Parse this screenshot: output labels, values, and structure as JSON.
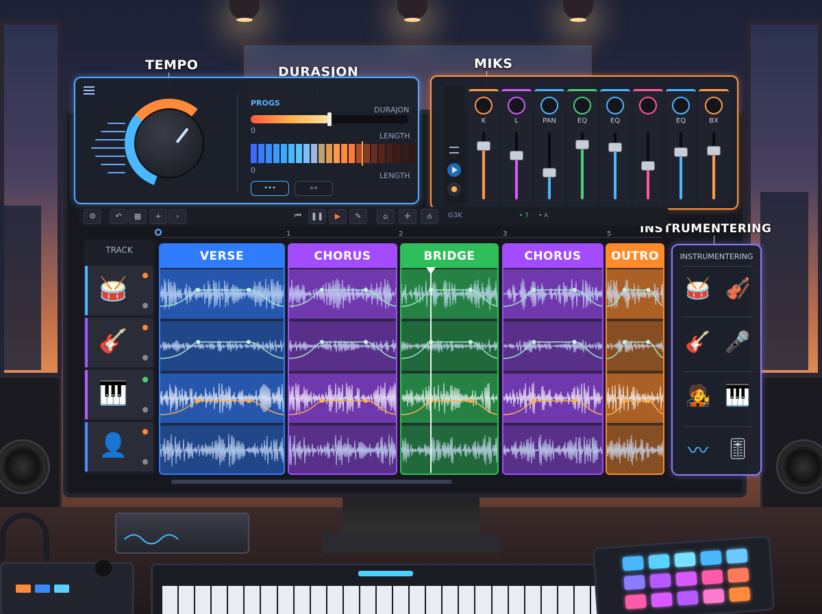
{
  "callouts": {
    "tempo": "TEMPO",
    "duration": "DURASJON",
    "mix": "MIKS",
    "instrumentation": "INSTRUMENTERING"
  },
  "tempo_panel": {
    "menu_icon": "hamburger-menu-icon",
    "progress_label": "PROGS",
    "duration_label": "DURAJON",
    "length_label_1": "LENGTH",
    "length_label_2": "LENGTH",
    "min_1": "0",
    "min_2": "0",
    "button_left": "•••",
    "button_right": "»»",
    "tempo_level": 0.62,
    "progress_level": 0.5
  },
  "mixer": {
    "channels": [
      {
        "label": "K",
        "color": "#ff9a4a"
      },
      {
        "label": "L",
        "color": "#d85aff"
      },
      {
        "label": "PAN",
        "color": "#4ab8ff"
      },
      {
        "label": "EQ",
        "color": "#4ad07a"
      },
      {
        "label": "EQ",
        "color": "#4ab8ff"
      },
      {
        "label": "",
        "color": "#ff5a9a"
      },
      {
        "label": "EQ",
        "color": "#4ab8ff"
      },
      {
        "label": "BX",
        "color": "#ff9a4a"
      }
    ]
  },
  "toolbar": {
    "counter": "G3K",
    "indicator_1": "• 7",
    "indicator_2": "• A"
  },
  "ruler": [
    "1",
    "2",
    "3",
    "5"
  ],
  "tracks": {
    "header": "TRACK",
    "items": [
      {
        "icon": "snare-drum-icon",
        "color": "#4ab8ff"
      },
      {
        "icon": "electric-guitar-icon",
        "color": "#9a5aff"
      },
      {
        "icon": "synth-keyboard-icon",
        "color": "#b45aff"
      },
      {
        "icon": "vocalist-icon",
        "color": "#4a8aff"
      }
    ]
  },
  "sections": [
    {
      "name": "VERSE",
      "color": "#2f7cff"
    },
    {
      "name": "CHORUS",
      "color": "#a24bff"
    },
    {
      "name": "BRIDGE",
      "color": "#2fbf5a"
    },
    {
      "name": "CHORUS",
      "color": "#a24bff"
    },
    {
      "name": "OUTRO",
      "color": "#ff8a2a"
    }
  ],
  "instruments": {
    "header": "INSTRUMENTERING",
    "items": [
      "drum-icon",
      "violin-icon",
      "acoustic-guitar-icon",
      "microphone-icon",
      "singer-icon",
      "keyboard-icon",
      "automation-curve-icon",
      "mixer-sliders-icon"
    ]
  }
}
